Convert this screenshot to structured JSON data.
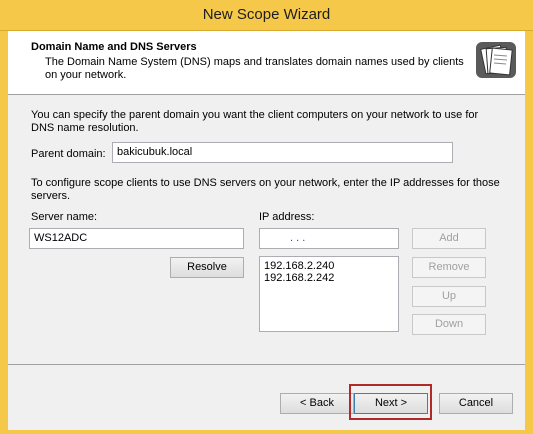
{
  "window": {
    "title": "New Scope Wizard"
  },
  "header": {
    "title": "Domain Name and DNS Servers",
    "description": "The Domain Name System (DNS) maps and translates domain names used by clients on your network.",
    "icon": "folder-stack-icon"
  },
  "parent_section": {
    "intro": "You can specify the parent domain you want the client computers on your network to use for DNS name resolution.",
    "parent_domain_label": "Parent domain:",
    "parent_domain_value": "bakicubuk.local"
  },
  "dns_section": {
    "intro": "To configure scope clients to use DNS servers on your network, enter the IP addresses for those servers.",
    "server_name_label": "Server name:",
    "server_name_value": "WS12ADC",
    "ip_address_label": "IP address:",
    "ip_address_value": ".   .   .",
    "resolve_label": "Resolve",
    "ip_list": [
      "192.168.2.240",
      "192.168.2.242"
    ],
    "add_label": "Add",
    "remove_label": "Remove",
    "up_label": "Up",
    "down_label": "Down"
  },
  "footer": {
    "back_label": "< Back",
    "next_label": "Next >",
    "cancel_label": "Cancel"
  },
  "colors": {
    "title_bar": "#f6c84a",
    "highlight": "#b02a2a"
  }
}
